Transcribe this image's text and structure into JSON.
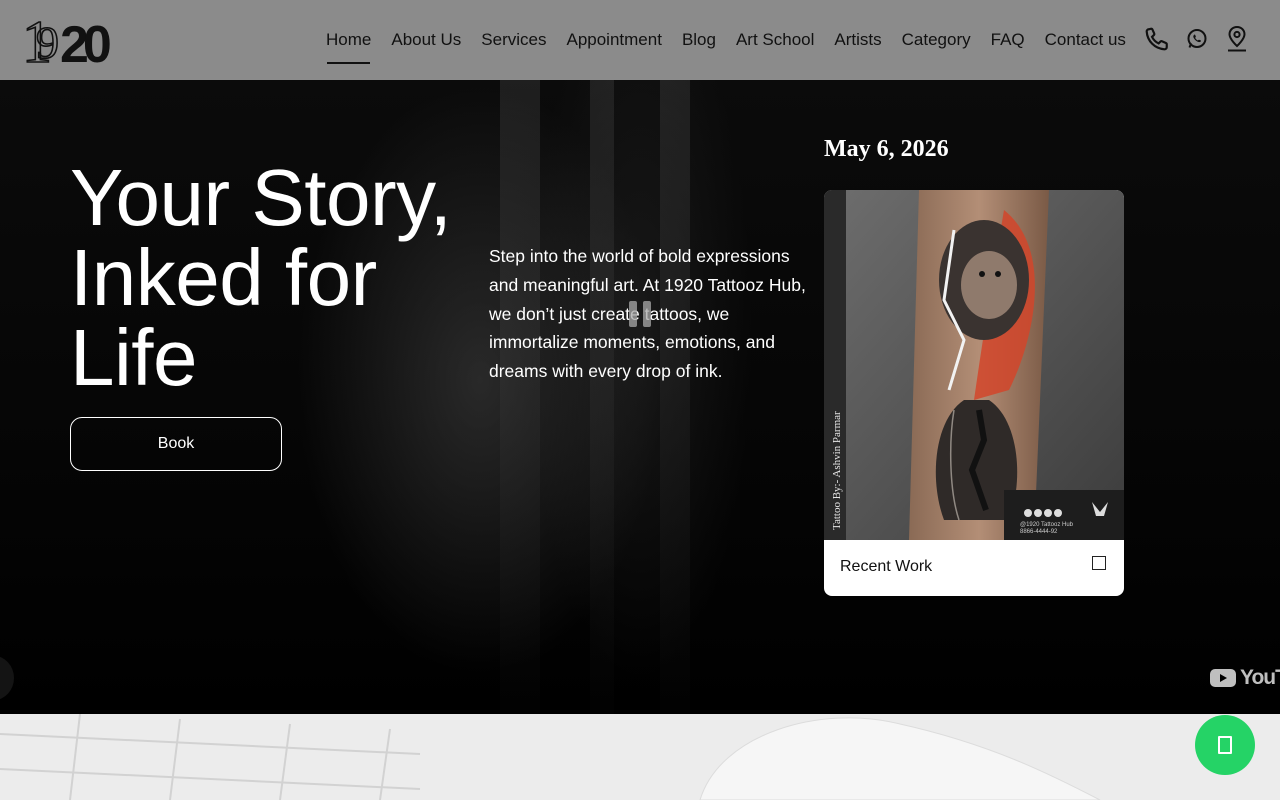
{
  "brand": {
    "logo_text": "1920"
  },
  "nav": {
    "items": [
      {
        "label": "Home",
        "active": true
      },
      {
        "label": "About Us"
      },
      {
        "label": "Services"
      },
      {
        "label": "Appointment"
      },
      {
        "label": "Blog"
      },
      {
        "label": "Art School"
      },
      {
        "label": "Artists"
      },
      {
        "label": "Category"
      },
      {
        "label": "FAQ"
      },
      {
        "label": "Contact us"
      }
    ],
    "icons": [
      "phone-icon",
      "whatsapp-icon",
      "location-pin-icon"
    ]
  },
  "hero": {
    "title_line1": "Your Story,",
    "title_line2": "Inked for",
    "title_line3": "Life",
    "book_label": "Book",
    "description": "Step into the world of bold expressions and meaningful art. At 1920 Tattooz Hub, we don’t just create tattoos, we immortalize moments, emotions, and dreams with every drop of ink.",
    "date": "May 6, 2026",
    "card": {
      "label": "Recent Work",
      "image_caption": "Tattoo By:- Ashvin Parmar",
      "image_footer_small": "@1920 Tattooz Hub",
      "image_footer_phone": "8866-4444-92"
    },
    "video_brand": "YouTube"
  },
  "colors": {
    "header_bg": "#8b8b8b",
    "hero_bg": "#050505",
    "chat_green": "#25d366",
    "tattoo_red": "#d2452a"
  }
}
